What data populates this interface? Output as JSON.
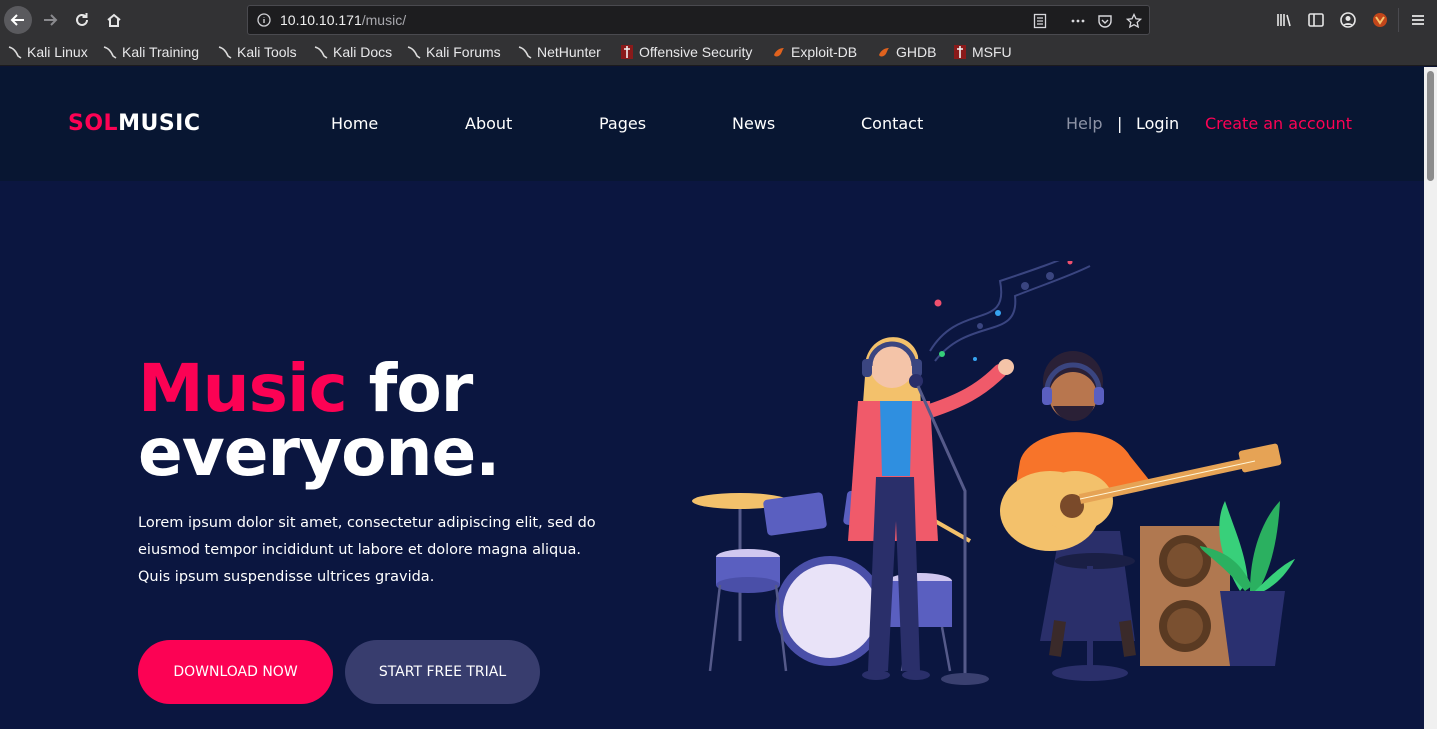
{
  "browser": {
    "url_host": "10.10.10.171",
    "url_path": "/music/",
    "bookmarks": [
      {
        "label": "Kali Linux",
        "icon": "kali-dragon-icon"
      },
      {
        "label": "Kali Training",
        "icon": "kali-dragon-icon"
      },
      {
        "label": "Kali Tools",
        "icon": "kali-dragon-icon"
      },
      {
        "label": "Kali Docs",
        "icon": "kali-dragon-icon"
      },
      {
        "label": "Kali Forums",
        "icon": "kali-dragon-icon"
      },
      {
        "label": "NetHunter",
        "icon": "kali-dragon-icon"
      },
      {
        "label": "Offensive Security",
        "icon": "offsec-icon"
      },
      {
        "label": "Exploit-DB",
        "icon": "exploitdb-icon"
      },
      {
        "label": "GHDB",
        "icon": "exploitdb-icon"
      },
      {
        "label": "MSFU",
        "icon": "offsec-icon"
      }
    ]
  },
  "site": {
    "logo_accent": "SOL",
    "logo_main": "MUSIC",
    "nav": {
      "home": "Home",
      "about": "About",
      "pages": "Pages",
      "news": "News",
      "contact": "Contact"
    },
    "help": "Help",
    "separator": "|",
    "login": "Login",
    "create_account": "Create an account"
  },
  "hero": {
    "title_accent": "Music",
    "title_rest_1": " for",
    "title_rest_2": "everyone.",
    "text": "Lorem ipsum dolor sit amet, consectetur adipiscing elit, sed do eiusmod tempor incididunt ut labore et dolore magna aliqua. Quis ipsum suspendisse ultrices gravida.",
    "download_label": "DOWNLOAD NOW",
    "trial_label": "START FREE TRIAL"
  },
  "colors": {
    "accent": "#fc0254",
    "header_bg": "#081632",
    "hero_bg": "#0b1640",
    "secondary_button": "#383d6e"
  }
}
